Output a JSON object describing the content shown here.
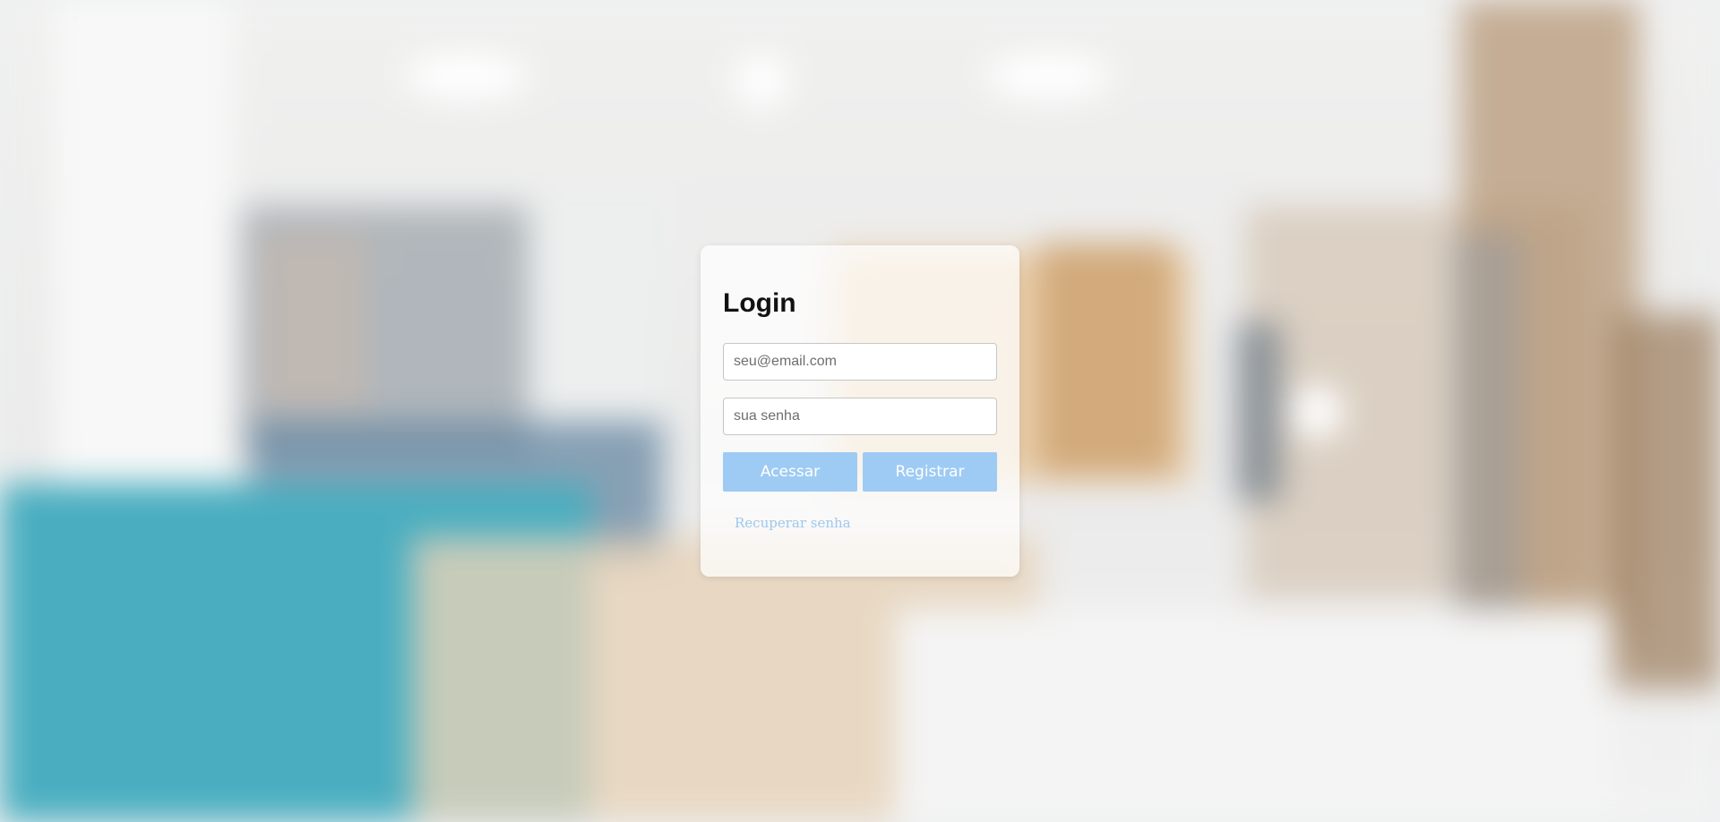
{
  "login": {
    "title": "Login",
    "email_placeholder": "seu@email.com",
    "password_placeholder": "sua senha",
    "access_label": "Acessar",
    "register_label": "Registrar",
    "recover_label": "Recuperar senha"
  },
  "colors": {
    "button_bg": "#9ecbf4",
    "button_text": "#ffffff",
    "link": "#9cc8ef",
    "card_bg": "rgba(255,255,255,0.72)"
  }
}
